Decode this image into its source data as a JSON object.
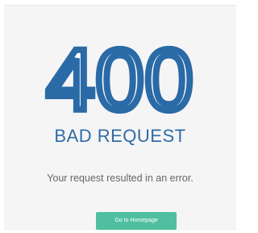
{
  "error": {
    "code": "400",
    "title": "BAD REQUEST",
    "message": "Your request resulted in an error."
  },
  "actions": {
    "homepage_label": "Go to Homepage"
  },
  "colors": {
    "code_outline": "#2a6aa7",
    "title": "#2f6ca6",
    "message": "#666666",
    "button_bg": "#4fbf9f",
    "button_text": "#ffffff",
    "card_bg": "#f5f5f5"
  }
}
